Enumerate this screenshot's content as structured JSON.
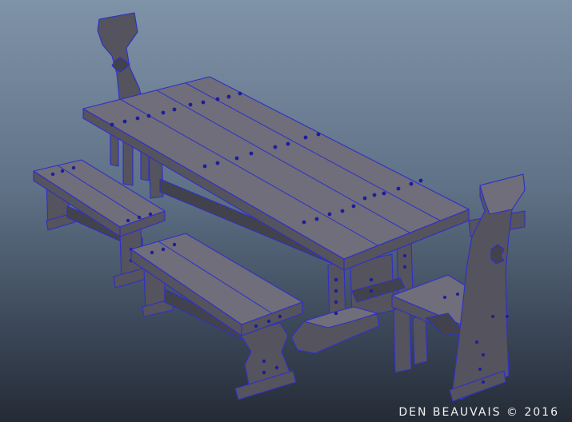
{
  "credit": "DEN BEAUVAIS © 2016",
  "colors": {
    "background_top": "#7f93a8",
    "background_bottom": "#242b36",
    "wood_top": "#6f6e7a",
    "wood_side": "#54535e",
    "wireframe_edge": "#2f2fc9",
    "credit_text": "#f2f2f2"
  }
}
